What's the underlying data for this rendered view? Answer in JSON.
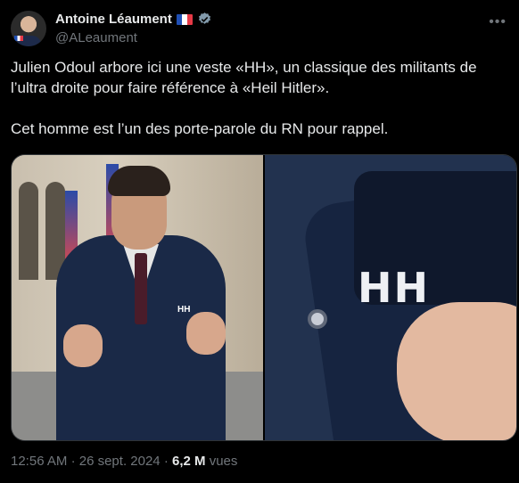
{
  "author": {
    "display_name": "Antoine Léaument",
    "handle": "@ALeaument"
  },
  "tweet": {
    "paragraph_1": "Julien Odoul arbore ici une veste «HH», un classique des militants de l’ultra droite pour faire référence à «Heil Hitler».",
    "paragraph_2": "Cet homme est l’un des porte-parole du RN pour rappel."
  },
  "media": {
    "left_logo_text": "HH",
    "right_logo_text": "HH"
  },
  "meta": {
    "time": "12:56 AM",
    "separator": "·",
    "date": "26 sept. 2024",
    "views_count": "6,2 M",
    "views_label": "vues"
  },
  "icons": {
    "flag": "france-flag-icon",
    "verified": "verified-badge-icon",
    "more": "more-options-icon"
  },
  "colors": {
    "background": "#000000",
    "text": "#e7e9ea",
    "secondary": "#71767b",
    "verified": "#829aab"
  }
}
